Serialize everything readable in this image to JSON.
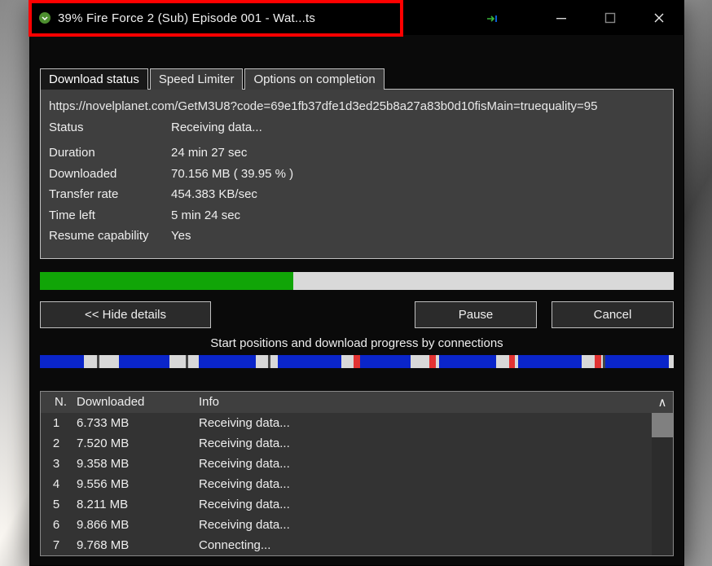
{
  "title": "39% Fire Force 2 (Sub) Episode 001 - Wat...ts",
  "tabs": [
    "Download status",
    "Speed Limiter",
    "Options on completion"
  ],
  "activeTab": 0,
  "url": "https://novelplanet.com/GetM3U8?code=69e1fb37dfe1d3ed25b8a27a83b0d10fisMain=truequality=95",
  "status_label": "Status",
  "status_value": "Receiving data...",
  "fields": [
    {
      "label": "Duration",
      "value": "24 min 27 sec"
    },
    {
      "label": "Downloaded",
      "value": "70.156  MB  ( 39.95 % )"
    },
    {
      "label": "Transfer rate",
      "value": "454.383  KB/sec"
    },
    {
      "label": "Time left",
      "value": "5 min 24 sec"
    },
    {
      "label": "Resume capability",
      "value": "        Yes"
    }
  ],
  "progressPercent": 40,
  "buttons": {
    "hide": "<< Hide details",
    "pause": "Pause",
    "cancel": "Cancel"
  },
  "segments_label": "Start positions and download progress by connections",
  "table": {
    "headers": {
      "n": "N.",
      "dl": "Downloaded",
      "info": "Info",
      "scroll": "∧"
    },
    "rows": [
      {
        "n": "1",
        "dl": "6.733  MB",
        "info": "Receiving data..."
      },
      {
        "n": "2",
        "dl": "7.520  MB",
        "info": "Receiving data..."
      },
      {
        "n": "3",
        "dl": "9.358  MB",
        "info": "Receiving data..."
      },
      {
        "n": "4",
        "dl": "9.556  MB",
        "info": "Receiving data..."
      },
      {
        "n": "5",
        "dl": "8.211  MB",
        "info": "Receiving data..."
      },
      {
        "n": "6",
        "dl": "9.866  MB",
        "info": "Receiving data..."
      },
      {
        "n": "7",
        "dl": "9.768  MB",
        "info": "Connecting..."
      }
    ]
  }
}
